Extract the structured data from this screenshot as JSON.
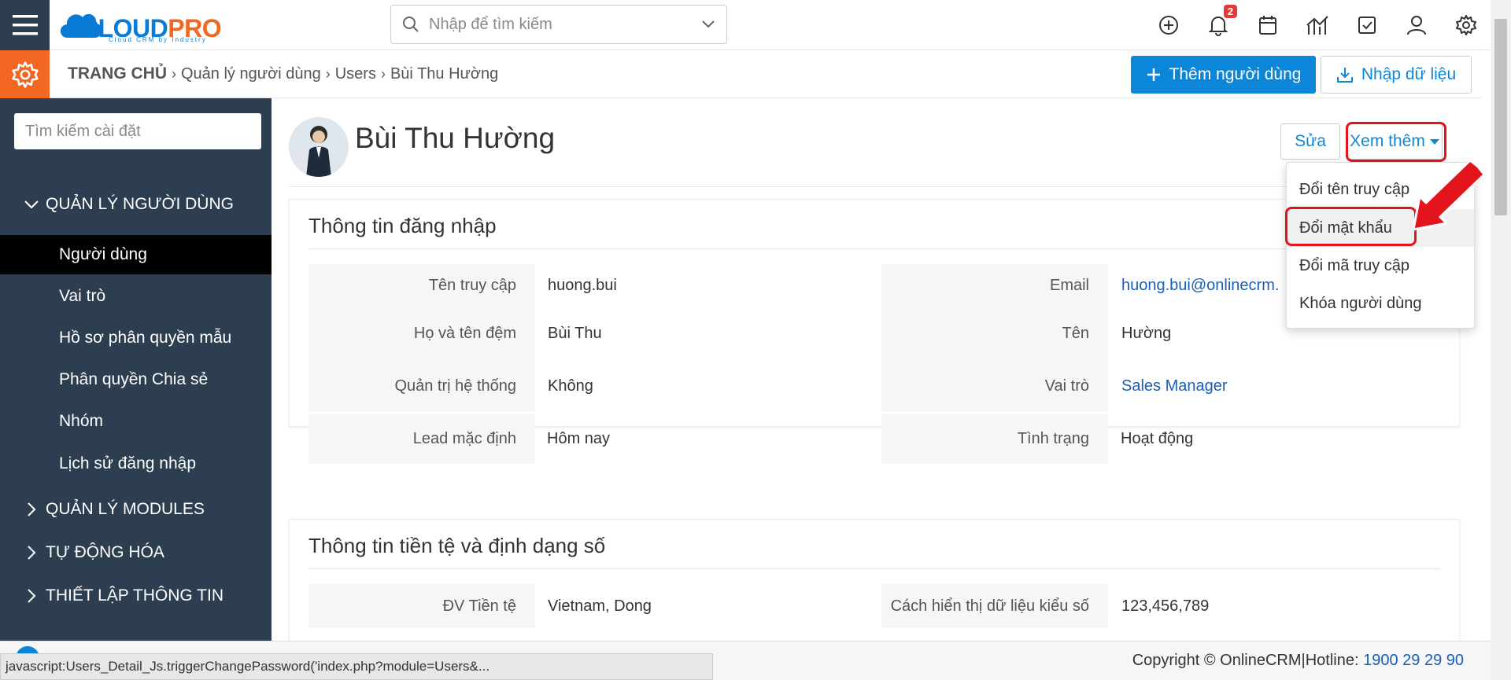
{
  "brand": {
    "cloud": "CLOUD",
    "pro": "PRO",
    "tagline": "Cloud CRM by Industry"
  },
  "search": {
    "placeholder": "Nhập để tìm kiếm"
  },
  "topicons": {
    "notification_count": "2"
  },
  "breadcrumb": {
    "home": "TRANG CHỦ",
    "level1": "Quản lý người dùng",
    "level2": "Users",
    "level3": "Bùi Thu Hường"
  },
  "actions": {
    "add_user": "Thêm người dùng",
    "import": "Nhập dữ liệu"
  },
  "sidebar": {
    "search_placeholder": "Tìm kiếm cài đặt",
    "section_users": "QUẢN LÝ NGƯỜI DÙNG",
    "items": [
      {
        "label": "Người dùng"
      },
      {
        "label": "Vai trò"
      },
      {
        "label": "Hồ sơ phân quyền mẫu"
      },
      {
        "label": "Phân quyền Chia sẻ"
      },
      {
        "label": "Nhóm"
      },
      {
        "label": "Lịch sử đăng nhập"
      }
    ],
    "section_modules": "QUẢN LÝ MODULES",
    "section_automation": "TỰ ĐỘNG HÓA",
    "section_setup": "THIẾT LẬP THÔNG TIN"
  },
  "user": {
    "name": "Bùi Thu Hường"
  },
  "detail_buttons": {
    "edit": "Sửa",
    "more": "Xem thêm"
  },
  "dropdown": {
    "items": [
      {
        "label": "Đổi tên truy cập"
      },
      {
        "label": "Đổi mật khẩu"
      },
      {
        "label": "Đổi mã truy cập"
      },
      {
        "label": "Khóa người dùng"
      }
    ]
  },
  "login_panel": {
    "title": "Thông tin đăng nhập",
    "fields": {
      "username_label": "Tên truy cập",
      "username": "huong.bui",
      "email_label": "Email",
      "email": "huong.bui@onlinecrm.",
      "middlename_label": "Họ và tên đệm",
      "middlename": "Bùi Thu",
      "firstname_label": "Tên",
      "firstname": "Hường",
      "admin_label": "Quản trị hệ thống",
      "admin": "Không",
      "role_label": "Vai trò",
      "role": "Sales Manager",
      "lead_label": "Lead mặc định",
      "lead": "Hôm nay",
      "status_label": "Tình trạng",
      "status": "Hoạt động"
    }
  },
  "currency_panel": {
    "title": "Thông tin tiền tệ và định dạng số",
    "fields": {
      "currency_label": "ĐV Tiền tệ",
      "currency": "Vietnam, Dong",
      "numformat_label": "Cách hiển thị dữ liệu kiểu số",
      "numformat": "123,456,789"
    }
  },
  "footer": {
    "status_url": "javascript:Users_Detail_Js.triggerChangePassword('index.php?module=Users&...",
    "copyright": "Copyright © OnlineCRM|Hotline: ",
    "hotline": "1900 29 29 90"
  },
  "colors": {
    "primary": "#0b86d9",
    "sidebar": "#2c3e50",
    "accent_orange": "#f26722",
    "highlight_red": "#e3141c"
  }
}
